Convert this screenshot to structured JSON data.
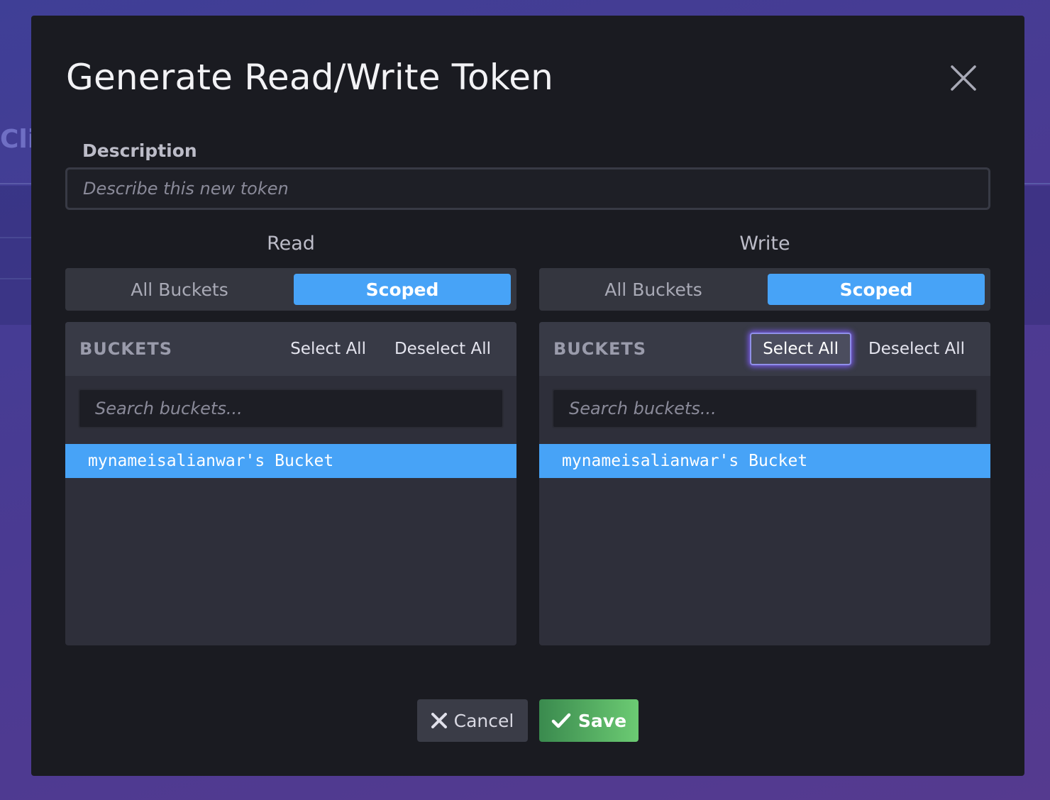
{
  "background": {
    "partial_title": "Cli"
  },
  "modal": {
    "title": "Generate Read/Write Token",
    "close_icon": "close-icon"
  },
  "description": {
    "label": "Description",
    "value": "",
    "placeholder": "Describe this new token"
  },
  "read": {
    "title": "Read",
    "toggle": {
      "options": [
        "All Buckets",
        "Scoped"
      ],
      "selected": "Scoped"
    },
    "buckets": {
      "header_label": "BUCKETS",
      "select_all": "Select All",
      "deselect_all": "Deselect All",
      "search_placeholder": "Search buckets...",
      "items": [
        {
          "name": "mynameisalianwar's Bucket",
          "selected": true
        }
      ]
    }
  },
  "write": {
    "title": "Write",
    "toggle": {
      "options": [
        "All Buckets",
        "Scoped"
      ],
      "selected": "Scoped"
    },
    "buckets": {
      "header_label": "BUCKETS",
      "select_all": "Select All",
      "deselect_all": "Deselect All",
      "search_placeholder": "Search buckets...",
      "items": [
        {
          "name": "mynameisalianwar's Bucket",
          "selected": true
        }
      ]
    }
  },
  "footer": {
    "cancel_label": "Cancel",
    "save_label": "Save"
  },
  "colors": {
    "accent": "#47a3f7",
    "save_gradient_start": "#3a8a4e",
    "save_gradient_end": "#6ccb73",
    "modal_bg": "#1a1b21"
  }
}
